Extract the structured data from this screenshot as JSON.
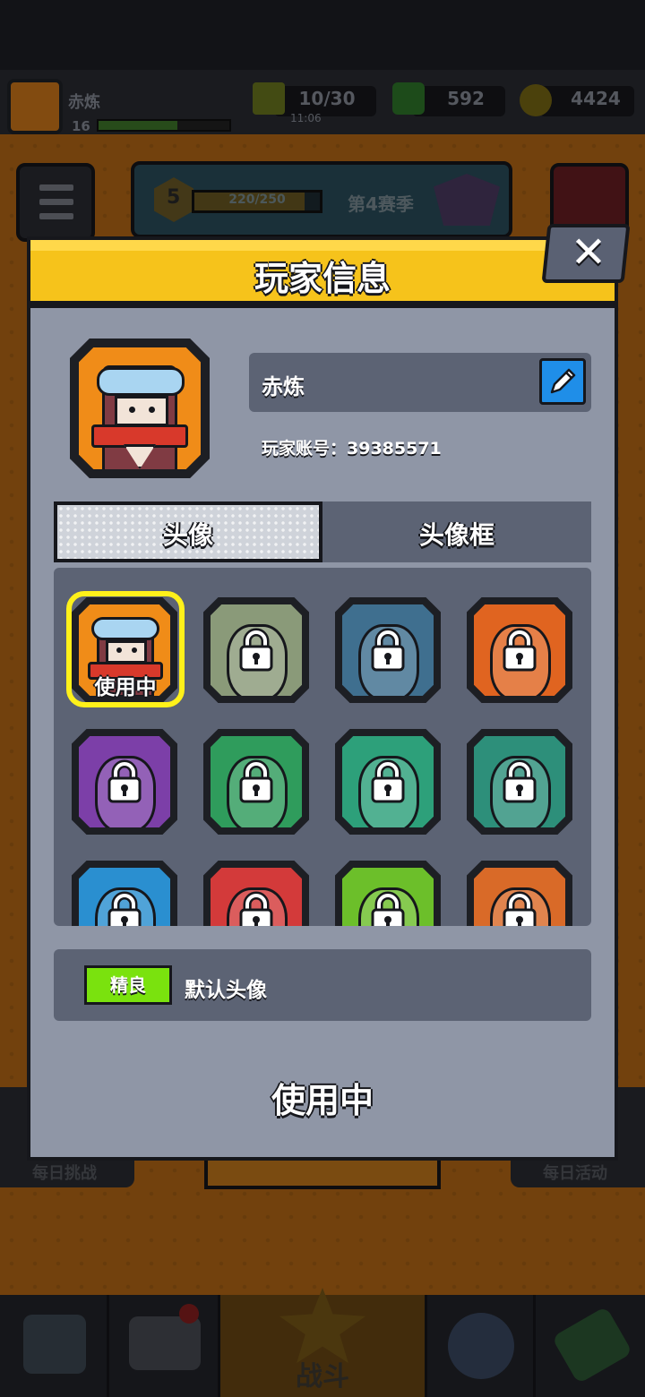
{
  "hud": {
    "player_name": "赤炼",
    "player_level": "16",
    "xp_progress": 0.6,
    "energy": "10/30",
    "energy_timer": "11:06",
    "gems": "592",
    "coins": "4424"
  },
  "season": {
    "level": "5",
    "xp": "220/250",
    "xp_progress": 0.88,
    "name": "第4赛季"
  },
  "bottom": {
    "daily_challenge": "每日挑战",
    "daily_activity": "每日活动",
    "battle": "战斗"
  },
  "dialog": {
    "title": "玩家信息",
    "close_icon": "close-icon",
    "player_name": "赤炼",
    "edit_icon": "pencil-icon",
    "account_id": "玩家账号：39385571",
    "tabs": [
      {
        "label": "头像",
        "active": true
      },
      {
        "label": "头像框",
        "active": false
      }
    ],
    "avatars": [
      {
        "theme": "masked-rogue",
        "color": "#f08c18",
        "locked": false,
        "selected": true,
        "label": "使用中"
      },
      {
        "theme": "green-agent",
        "color": "#8a9a79",
        "locked": true
      },
      {
        "theme": "shark-man",
        "color": "#3f6f8f",
        "locked": true
      },
      {
        "theme": "red-beret-soldier",
        "color": "#e06420",
        "locked": true
      },
      {
        "theme": "purple-mushroom",
        "color": "#7c3fa8",
        "locked": true
      },
      {
        "theme": "pink-beast",
        "color": "#2f9c5c",
        "locked": true
      },
      {
        "theme": "flower-frog",
        "color": "#2da07a",
        "locked": true
      },
      {
        "theme": "pirate-ship",
        "color": "#2d8f7a",
        "locked": true
      },
      {
        "theme": "pirate-captain",
        "color": "#2a8fd0",
        "locked": true
      },
      {
        "theme": "red-hood",
        "color": "#d33a3a",
        "locked": true
      },
      {
        "theme": "gray-cat",
        "color": "#6cbf2a",
        "locked": true
      },
      {
        "theme": "hooded-dog",
        "color": "#d96a28",
        "locked": true
      }
    ],
    "selected_info": {
      "rarity": "精良",
      "rarity_color": "#7ae20e",
      "name": "默认头像"
    },
    "in_use_label": "使用中"
  }
}
